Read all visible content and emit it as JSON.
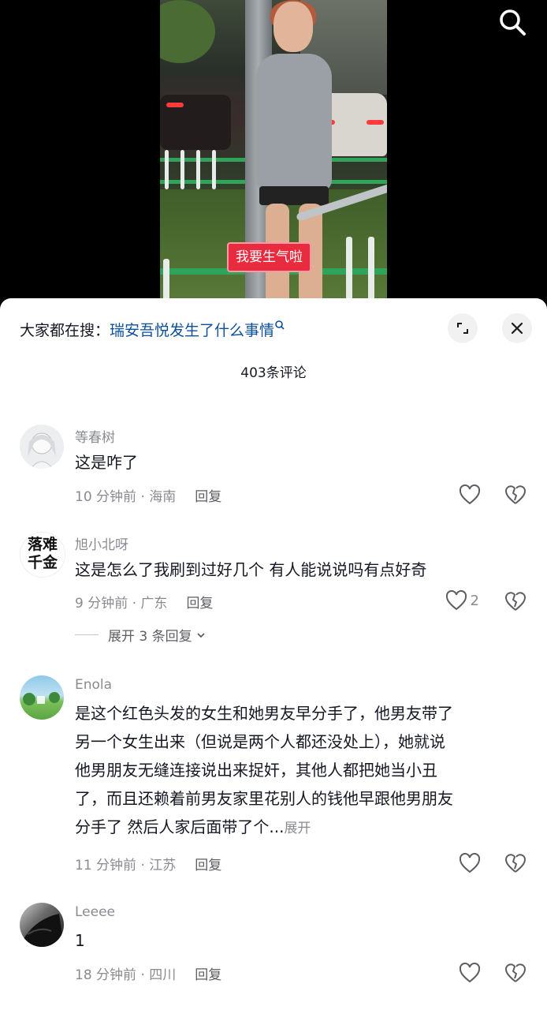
{
  "video": {
    "caption_sticker": "我要生气啦"
  },
  "sheet": {
    "hot_search_prefix": "大家都在搜：",
    "hot_search_query": "瑞安吾悦发生了什么事情",
    "comment_count": "403条评论"
  },
  "comments": [
    {
      "name": "等春树",
      "text": "这是咋了",
      "meta": "10 分钟前 · 海南",
      "reply": "回复",
      "likes": ""
    },
    {
      "name": "旭小北呀",
      "avatar_text": "落难千金",
      "text": "这是怎么了我刷到过好几个 有人能说说吗有点好奇",
      "meta": "9 分钟前 · 广东",
      "reply": "回复",
      "likes": "2",
      "expand": "展开 3 条回复"
    },
    {
      "name": "Enola",
      "text_lines": [
        "是这个红色头发的女生和她男友早分手了，他男友带了",
        "另一个女生出来（但说是两个人都还没处上），她就说",
        "他男朋友无缝连接说出来捉奸，其他人都把她当小丑",
        "了，而且还赖着前男友家里花别人的钱他早跟他男朋友",
        "分手了 然后人家后面带了个..."
      ],
      "more": "展开",
      "meta": "11 分钟前 · 江苏",
      "reply": "回复",
      "likes": ""
    },
    {
      "name": "Leeee",
      "text": "1",
      "meta": "18 分钟前 · 四川",
      "reply": "回复",
      "likes": ""
    }
  ],
  "colors": {
    "accent_link": "#0b4f9c",
    "sticker_red": "#e82b3e",
    "muted": "#8a8b91"
  },
  "icons": [
    "search-icon",
    "expand-icon",
    "close-icon",
    "heart-icon",
    "dislike-icon",
    "chevron-down-icon"
  ]
}
